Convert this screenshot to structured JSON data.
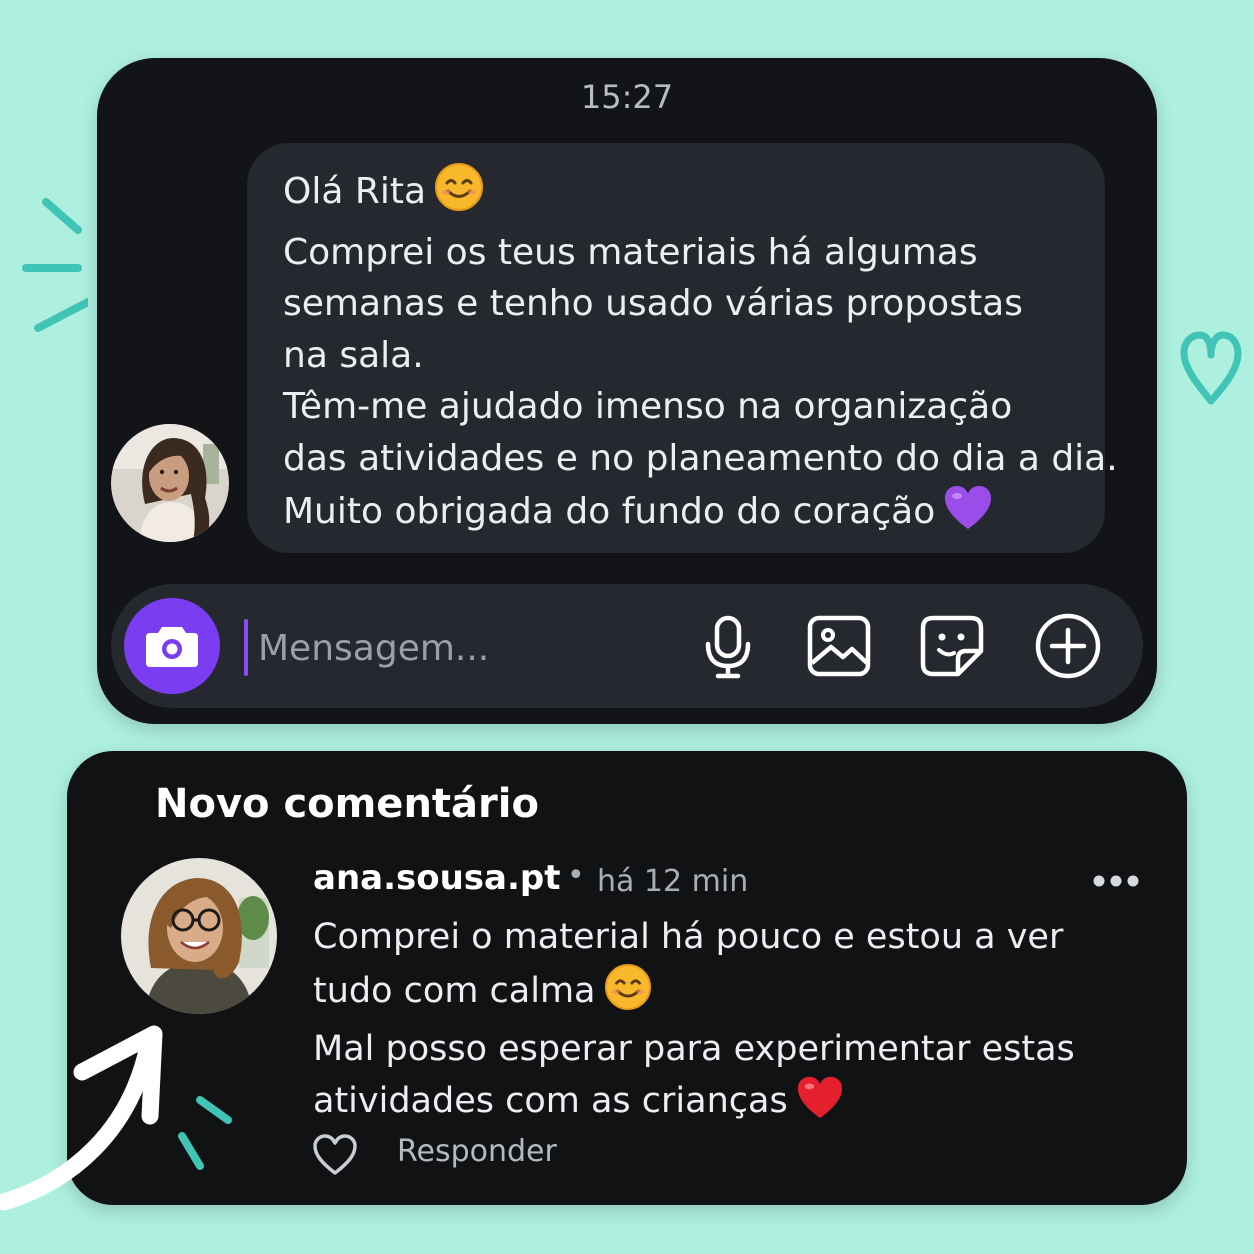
{
  "colors": {
    "background": "#aef0e0",
    "card": "#121417",
    "bubble": "#25282e",
    "accent": "#7b3df2"
  },
  "dm": {
    "time": "15:27",
    "message_lines": [
      "Olá Rita",
      "Comprei os teus materiais há algumas",
      "semanas e tenho usado várias propostas",
      "na sala.",
      "Têm-me ajudado imenso na organização",
      "das atividades e no planeamento do dia a dia.",
      "Muito obrigada do fundo do coração"
    ],
    "composer": {
      "placeholder": "Mensagem...",
      "icons": [
        "camera-icon",
        "microphone-icon",
        "gallery-icon",
        "sticker-icon",
        "plus-icon"
      ]
    }
  },
  "comment": {
    "title": "Novo comentário",
    "username": "ana.sousa.pt",
    "separator": "•",
    "time": "há 12 min",
    "text_lines": [
      "Comprei o material há pouco e estou a ver",
      "tudo com calma",
      "Mal posso esperar para experimentar estas",
      "atividades com as crianças"
    ],
    "reply_label": "Responder",
    "icons": [
      "more-icon",
      "heart-outline-icon"
    ]
  }
}
